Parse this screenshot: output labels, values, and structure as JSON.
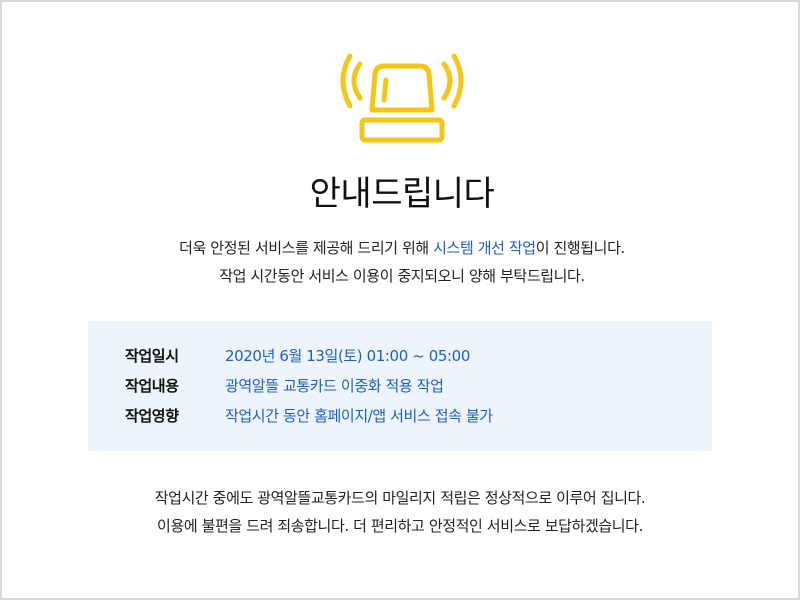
{
  "colors": {
    "accent": "#1f5fbf",
    "alarm_yellow": "#f5c518",
    "info_background": "#eef4fc",
    "border": "#d9d9d9"
  },
  "icon": "alarm-siren-icon",
  "title": "안내드립니다",
  "intro": {
    "line1_before": "더욱 안정된 서비스를 제공해 드리기 위해 ",
    "line1_highlight": "시스템 개선 작업",
    "line1_after": "이 진행됩니다.",
    "line2": "작업 시간동안 서비스 이용이 중지되오니 양해 부탁드립니다."
  },
  "info": {
    "rows": [
      {
        "label": "작업일시",
        "value": "2020년 6월 13일(토) 01:00 ~ 05:00"
      },
      {
        "label": "작업내용",
        "value": "광역알뜰 교통카드 이중화 적용 작업"
      },
      {
        "label": "작업영향",
        "value": "작업시간 동안 홈페이지/앱 서비스 접속 불가"
      }
    ]
  },
  "notice": {
    "line1": "작업시간 중에도 광역알뜰교통카드의 마일리지 적립은 정상적으로 이루어 집니다.",
    "line2": "이용에 불편을 드려 죄송합니다. 더 편리하고 안정적인 서비스로 보답하겠습니다."
  }
}
